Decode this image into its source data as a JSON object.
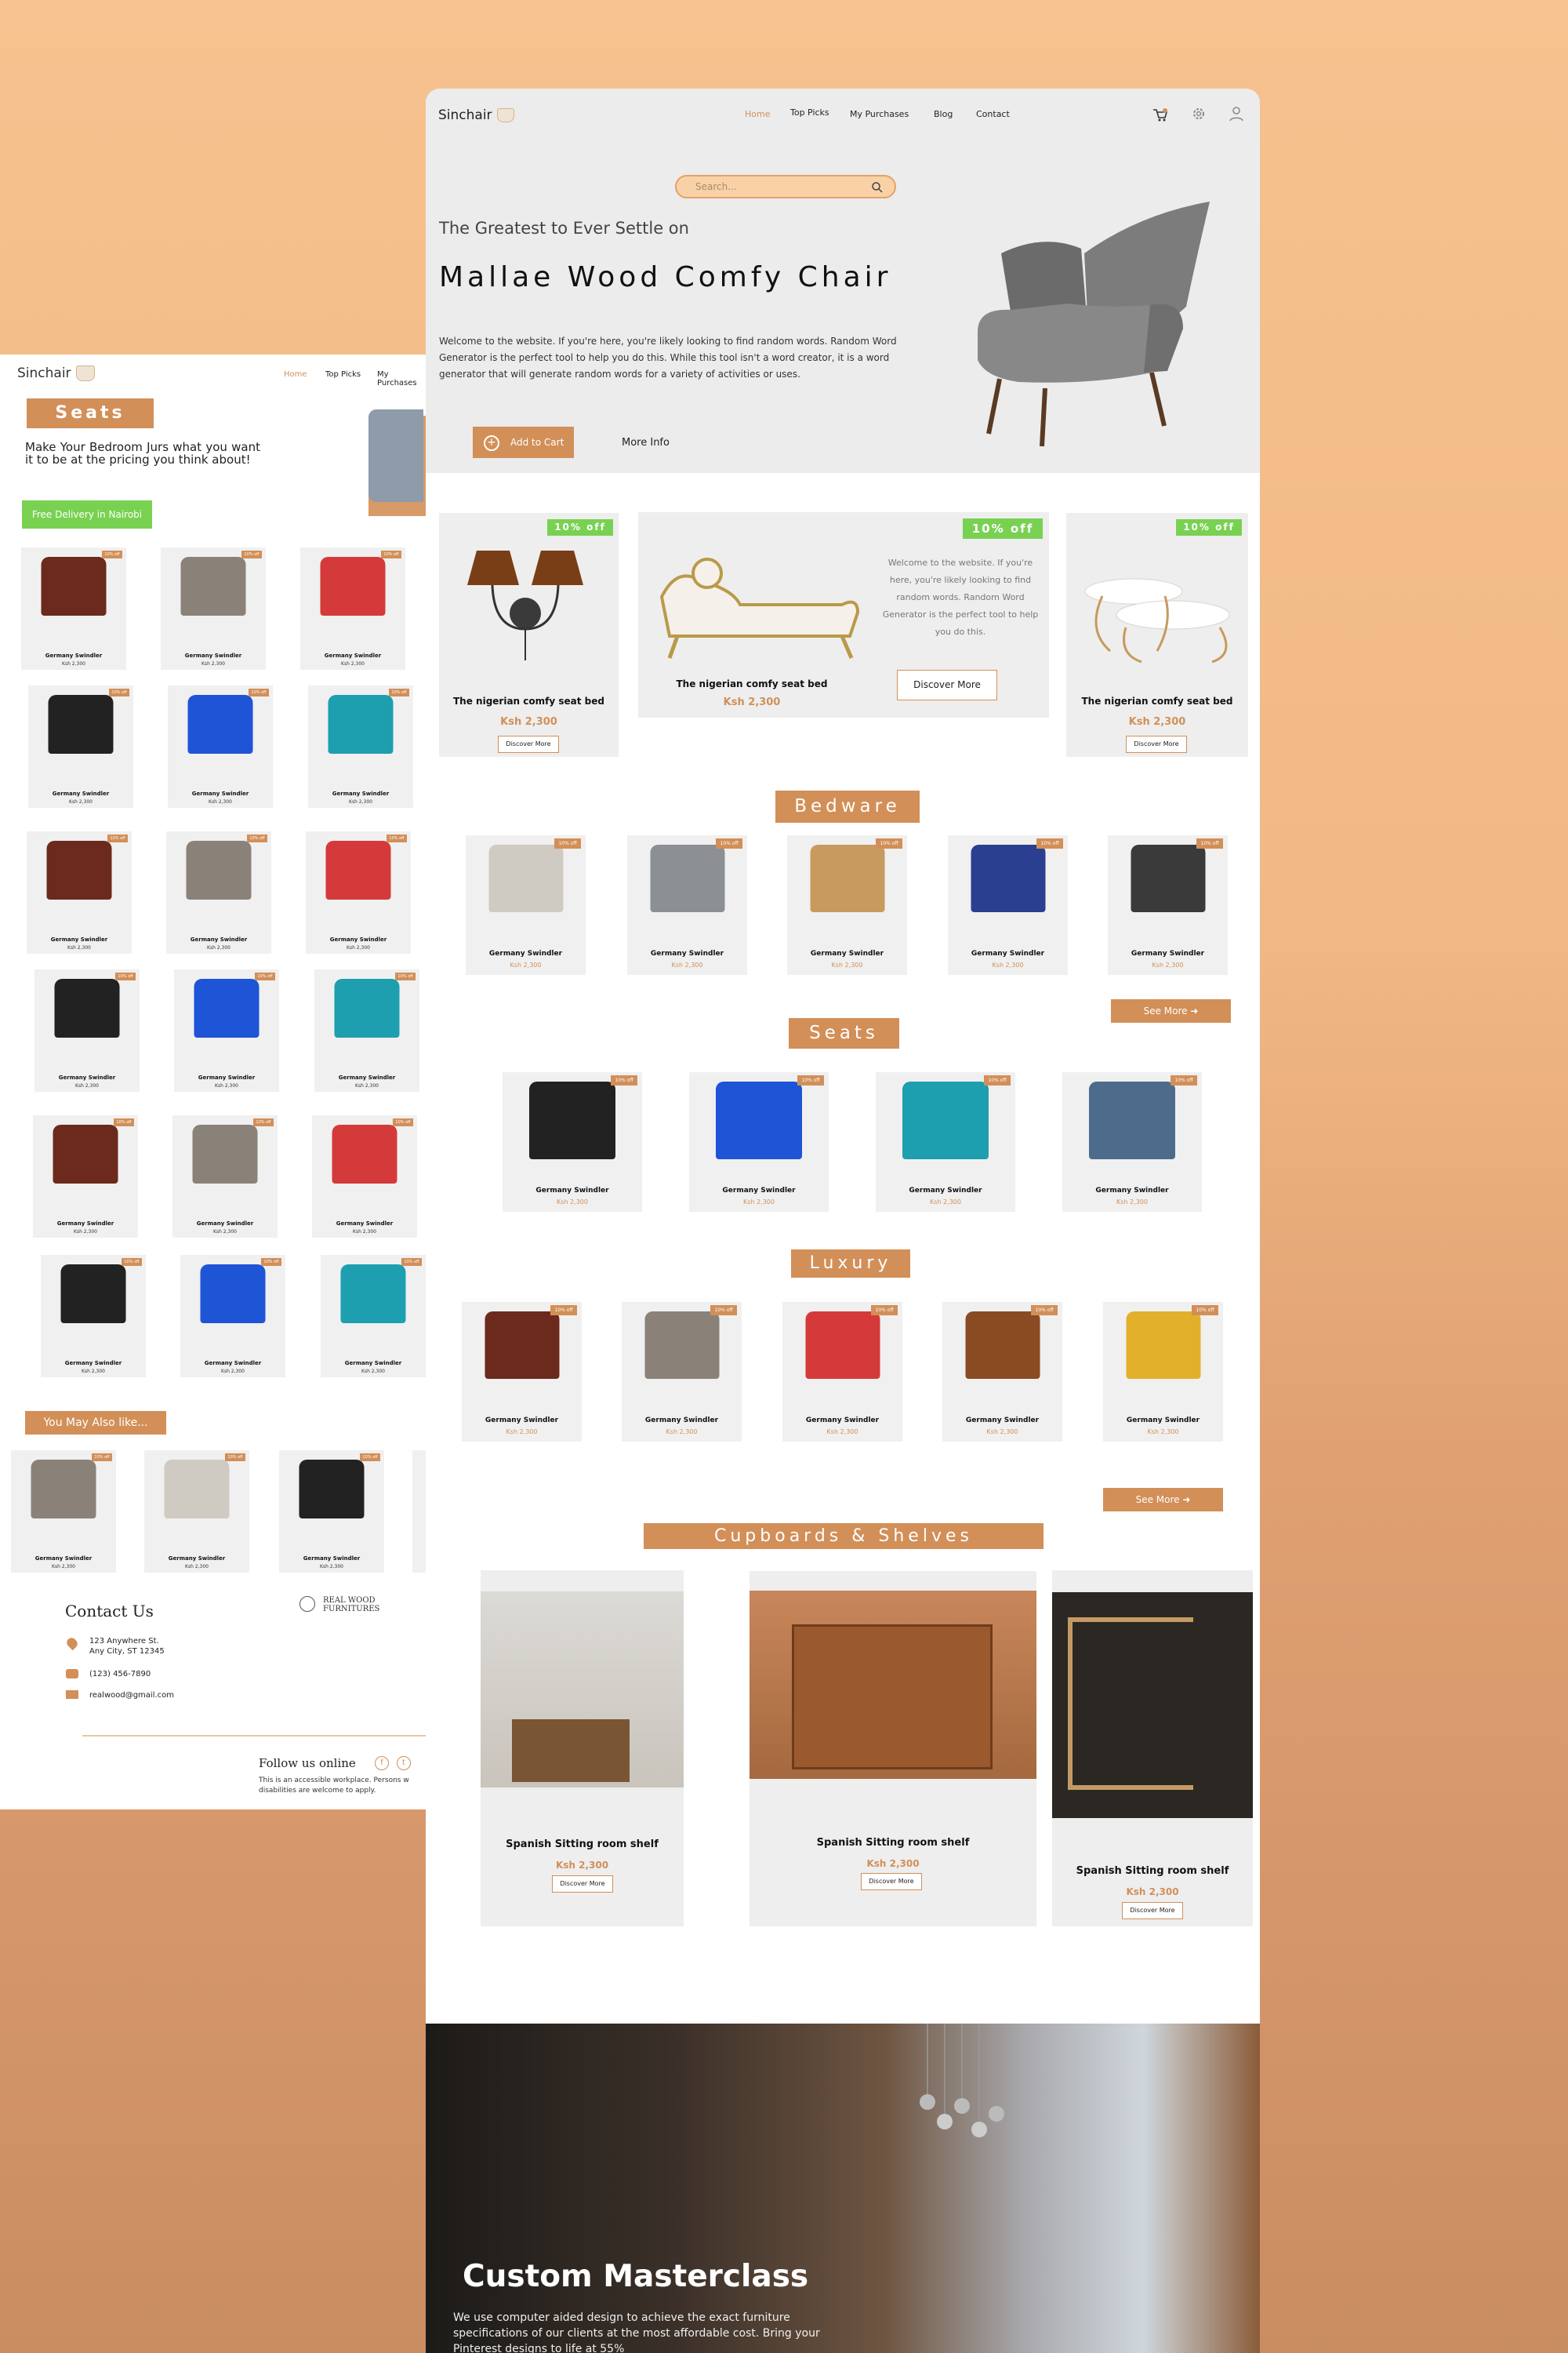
{
  "brand": {
    "accent": "#d28f58",
    "green": "#79d152",
    "card_bg": "#f0f0f0"
  },
  "left_page": {
    "logo": "Sinchair",
    "nav": [
      "Home",
      "Top Picks",
      "My Purchases"
    ],
    "section_title": "Seats",
    "description": "Make Your Bedroom Jurs what you want it to be at the pricing you think about!",
    "delivery_badge": "Free Delivery in Nairobi",
    "grid_tag": "10% off",
    "grid_name": "Germany Swindler",
    "grid_price": "Ksh 2,300",
    "also_like": "You May Also like...",
    "contact_title": "Contact Us",
    "address_line1": "123 Anywhere St.",
    "address_line2": "Any City, ST 12345",
    "phone": "(123) 456-7890",
    "email": "realwood@gmail.com",
    "logo2_line1": "REAL WOOD",
    "logo2_line2": "FURNITURES",
    "follow": "Follow us online",
    "social_fb": "f",
    "social_tw": "t",
    "note": "This is an accessible workplace. Persons w disabilities are welcome to apply."
  },
  "main_page": {
    "logo": "Sinchair",
    "nav": [
      "Home",
      "Top Picks",
      "My Purchases",
      "Blog",
      "Contact"
    ],
    "search_placeholder": "Search...",
    "eyebrow": "The Greatest to Ever Settle on",
    "headline": "Mallae Wood Comfy Chair",
    "intro": "Welcome to the website. If you're here, you're likely looking to find random words. Random Word Generator is the perfect tool to help you do this. While this tool isn't a word creator, it is a word generator that will generate random words for a variety of activities or uses.",
    "add_to_cart": "Add to Cart",
    "more_info": "More Info",
    "promos": [
      {
        "off": "10% off",
        "name": "The nigerian comfy seat bed",
        "price": "Ksh 2,300",
        "button": "Discover More"
      },
      {
        "off": "10% off",
        "name": "The nigerian comfy seat bed",
        "price": "Ksh 2,300",
        "button": "Discover More",
        "text": "Welcome to the website. If you're here, you're likely looking to find random words. Random Word Generator is the perfect tool to help you do this."
      },
      {
        "off": "10% off",
        "name": "The nigerian comfy seat bed",
        "price": "Ksh 2,300",
        "button": "Discover More"
      }
    ],
    "bedware_title": "Bedware",
    "seats_title": "Seats",
    "luxury_title": "Luxury",
    "shelves_title": "Cupboards & Shelves",
    "product_tag": "10% off",
    "product_name": "Germany Swindler",
    "product_price": "Ksh 2,300",
    "see_more": "See More",
    "shelves": [
      {
        "name": "Spanish Sitting room shelf",
        "price": "Ksh 2,300",
        "button": "Discover More"
      },
      {
        "name": "Spanish Sitting room shelf",
        "price": "Ksh 2,300",
        "button": "Discover More"
      },
      {
        "name": "Spanish Sitting room shelf",
        "price": "Ksh 2,300",
        "button": "Discover More"
      }
    ],
    "masterclass_title": "Custom Masterclass",
    "masterclass_text": "We use computer aided design to achieve the exact furniture specifications of our clients at the most affordable cost. Bring your Pinterest designs to life at 55%"
  }
}
